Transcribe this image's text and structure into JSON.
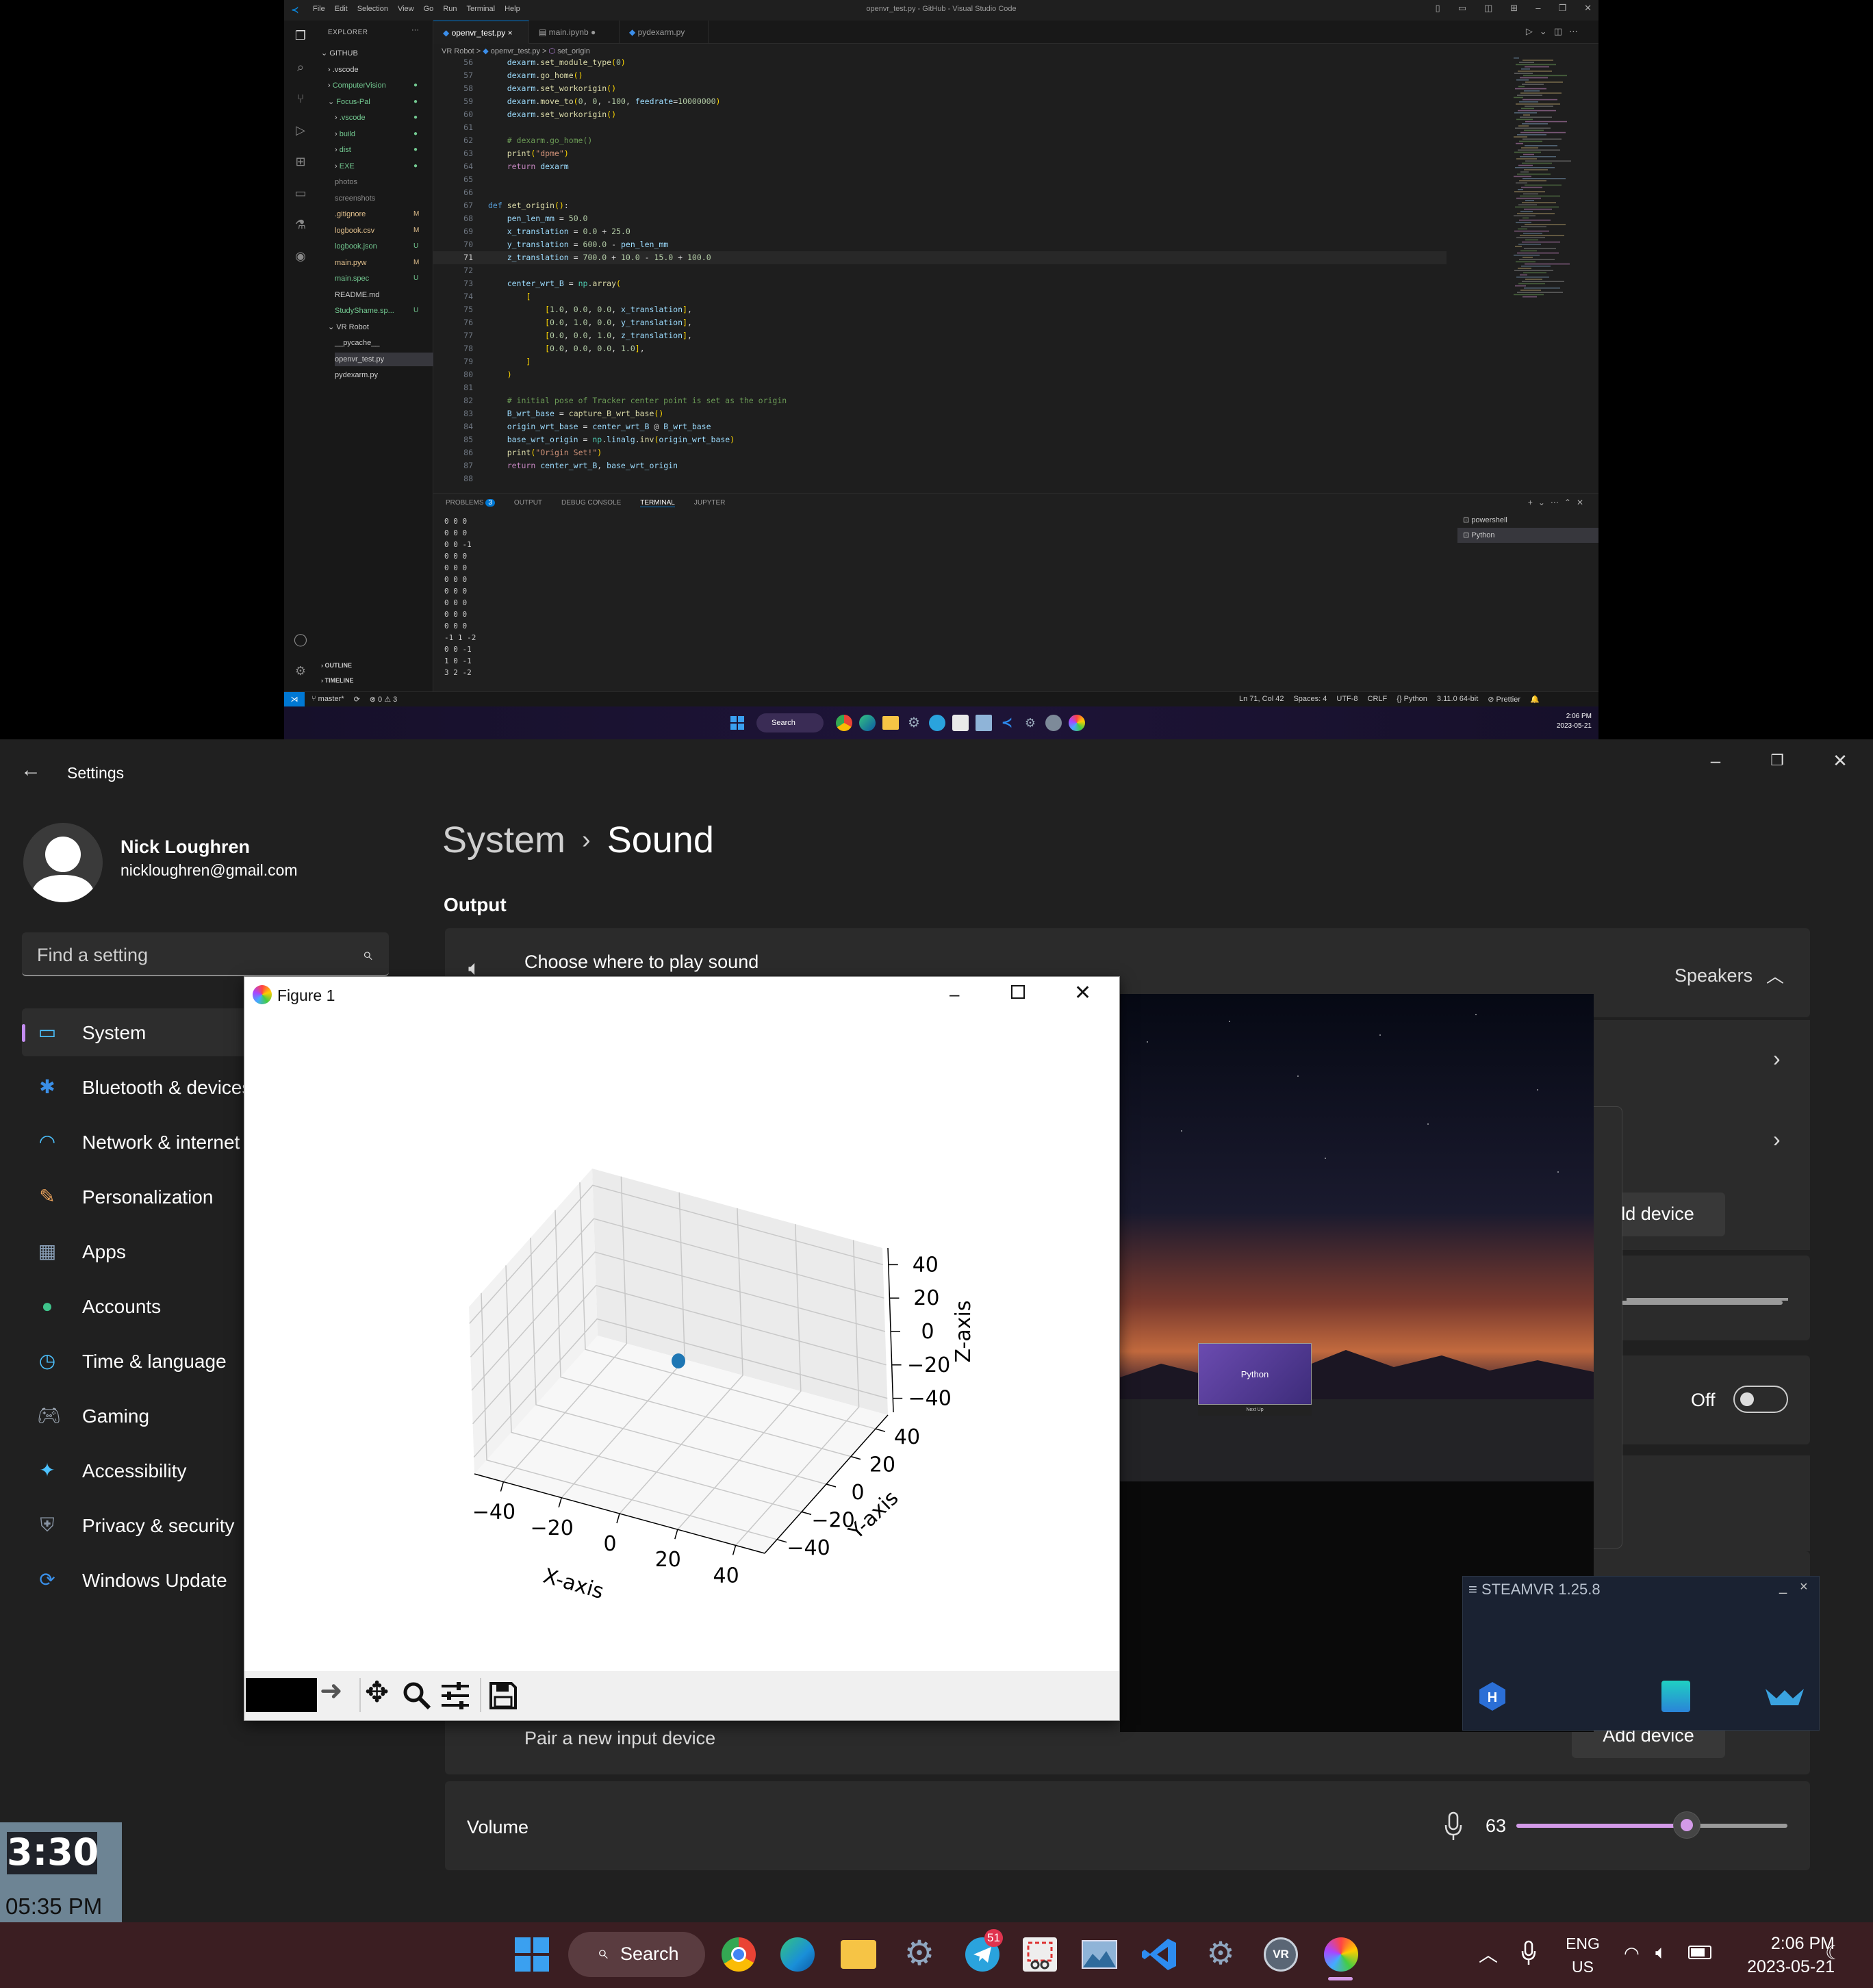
{
  "vscode": {
    "window_title": "openvr_test.py - GitHub - Visual Studio Code",
    "menu": [
      "File",
      "Edit",
      "Selection",
      "View",
      "Go",
      "Run",
      "Terminal",
      "Help"
    ],
    "explorer_header": "EXPLORER",
    "explorer_more": "···",
    "tree": [
      {
        "label": "GITHUB",
        "status": ""
      },
      {
        "label": ".vscode",
        "status": ""
      },
      {
        "label": "ComputerVision",
        "status": "●"
      },
      {
        "label": "Focus-Pal",
        "status": "●"
      },
      {
        "label": ".vscode",
        "status": "●"
      },
      {
        "label": "build",
        "status": "●"
      },
      {
        "label": "dist",
        "status": "●"
      },
      {
        "label": "EXE",
        "status": "●"
      },
      {
        "label": "photos",
        "status": ""
      },
      {
        "label": "screenshots",
        "status": ""
      },
      {
        "label": ".gitignore",
        "status": "M"
      },
      {
        "label": "logbook.csv",
        "status": "M"
      },
      {
        "label": "logbook.json",
        "status": "U"
      },
      {
        "label": "main.pyw",
        "status": "M"
      },
      {
        "label": "main.spec",
        "status": "U"
      },
      {
        "label": "README.md",
        "status": ""
      },
      {
        "label": "StudyShame.sp...",
        "status": "U"
      },
      {
        "label": "VR Robot",
        "status": ""
      },
      {
        "label": "__pycache__",
        "status": ""
      },
      {
        "label": "openvr_test.py",
        "status": ""
      },
      {
        "label": "pydexarm.py",
        "status": ""
      }
    ],
    "outline": "OUTLINE",
    "timeline": "TIMELINE",
    "tabs": [
      {
        "label": "openvr_test.py",
        "mark": "×"
      },
      {
        "label": "main.ipynb",
        "mark": "●"
      },
      {
        "label": "pydexarm.py",
        "mark": ""
      }
    ],
    "breadcrumb": [
      "VR Robot",
      ">",
      "openvr_test.py",
      ">",
      "set_origin"
    ],
    "code": [
      {
        "n": "56",
        "t": "    dexarm.set_module_type(0)"
      },
      {
        "n": "57",
        "t": "    dexarm.go_home()"
      },
      {
        "n": "58",
        "t": "    dexarm.set_workorigin()"
      },
      {
        "n": "59",
        "t": "    dexarm.move_to(0, 0, -100, feedrate=10000000)"
      },
      {
        "n": "60",
        "t": "    dexarm.set_workorigin()"
      },
      {
        "n": "61",
        "t": ""
      },
      {
        "n": "62",
        "t": "    # dexarm.go_home()"
      },
      {
        "n": "63",
        "t": "    print(\"dpme\")"
      },
      {
        "n": "64",
        "t": "    return dexarm"
      },
      {
        "n": "65",
        "t": ""
      },
      {
        "n": "66",
        "t": ""
      },
      {
        "n": "67",
        "t": "def set_origin():"
      },
      {
        "n": "68",
        "t": "    pen_len_mm = 50.0"
      },
      {
        "n": "69",
        "t": "    x_translation = 0.0 + 25.0"
      },
      {
        "n": "70",
        "t": "    y_translation = 600.0 - pen_len_mm"
      },
      {
        "n": "71",
        "t": "    z_translation = 700.0 + 10.0 - 15.0 + 100.0"
      },
      {
        "n": "72",
        "t": ""
      },
      {
        "n": "73",
        "t": "    center_wrt_B = np.array("
      },
      {
        "n": "74",
        "t": "        ["
      },
      {
        "n": "75",
        "t": "            [1.0, 0.0, 0.0, x_translation],"
      },
      {
        "n": "76",
        "t": "            [0.0, 1.0, 0.0, y_translation],"
      },
      {
        "n": "77",
        "t": "            [0.0, 0.0, 1.0, z_translation],"
      },
      {
        "n": "78",
        "t": "            [0.0, 0.0, 0.0, 1.0],"
      },
      {
        "n": "79",
        "t": "        ]"
      },
      {
        "n": "80",
        "t": "    )"
      },
      {
        "n": "81",
        "t": ""
      },
      {
        "n": "82",
        "t": "    # initial pose of Tracker center point is set as the origin"
      },
      {
        "n": "83",
        "t": "    B_wrt_base = capture_B_wrt_base()"
      },
      {
        "n": "84",
        "t": "    origin_wrt_base = center_wrt_B @ B_wrt_base"
      },
      {
        "n": "85",
        "t": "    base_wrt_origin = np.linalg.inv(origin_wrt_base)"
      },
      {
        "n": "86",
        "t": "    print(\"Origin Set!\")"
      },
      {
        "n": "87",
        "t": "    return center_wrt_B, base_wrt_origin"
      },
      {
        "n": "88",
        "t": ""
      }
    ],
    "panel_tabs": [
      "PROBLEMS",
      "OUTPUT",
      "DEBUG CONSOLE",
      "TERMINAL",
      "JUPYTER"
    ],
    "problems_count": "3",
    "terminal_lines": [
      "0 0 0",
      "0 0 0",
      "0 0 -1",
      "0 0 0",
      "0 0 0",
      "0 0 0",
      "0 0 0",
      "0 0 0",
      "0 0 0",
      "0 0 0",
      "-1 1 -2",
      "0 0 -1",
      "1 0 -1",
      "3 2 -2"
    ],
    "shells": [
      "powershell",
      "Python"
    ],
    "status_left": [
      "master*",
      "⟳",
      "⊗ 0 ⚠ 3"
    ],
    "status_right": [
      "Ln 71, Col 42",
      "Spaces: 4",
      "UTF-8",
      "CRLF",
      "{} Python",
      "3.11.0 64-bit",
      "⊘ Prettier"
    ],
    "taskbar_search": "Search",
    "taskbar_time": "2:06 PM",
    "taskbar_date": "2023-05-21",
    "badge_count": "51"
  },
  "settings": {
    "title": "Settings",
    "user_name": "Nick Loughren",
    "user_email": "nickloughren@gmail.com",
    "search_placeholder": "Find a setting",
    "nav": [
      {
        "label": "System",
        "icon": "monitor-icon"
      },
      {
        "label": "Bluetooth & devices",
        "icon": "bluetooth-icon"
      },
      {
        "label": "Network & internet",
        "icon": "wifi-icon"
      },
      {
        "label": "Personalization",
        "icon": "brush-icon"
      },
      {
        "label": "Apps",
        "icon": "apps-icon"
      },
      {
        "label": "Accounts",
        "icon": "accounts-icon"
      },
      {
        "label": "Time & language",
        "icon": "clock-icon"
      },
      {
        "label": "Gaming",
        "icon": "gamepad-icon"
      },
      {
        "label": "Accessibility",
        "icon": "accessibility-icon"
      },
      {
        "label": "Privacy & security",
        "icon": "shield-icon"
      },
      {
        "label": "Windows Update",
        "icon": "update-icon"
      }
    ],
    "breadcrumb_parent": "System",
    "breadcrumb_sep": "›",
    "breadcrumb_current": "Sound",
    "section_output": "Output",
    "choose_sound": "Choose where to play sound",
    "speakers": "Speakers",
    "add_device": "Add device",
    "off_label": "Off",
    "pair_input": "Pair a new input device",
    "volume_label": "Volume",
    "volume_value": "63",
    "volume_level": 0.63
  },
  "figure": {
    "title": "Figure 1"
  },
  "chart_data": {
    "type": "scatter",
    "projection": "3d",
    "title": "",
    "xlabel": "X-axis",
    "ylabel": "Y-axis",
    "zlabel": "Z-axis",
    "xlim": [
      -50,
      50
    ],
    "ylim": [
      -50,
      50
    ],
    "zlim": [
      -50,
      50
    ],
    "x_ticks": [
      "−40",
      "−20",
      "0",
      "20",
      "40"
    ],
    "y_ticks": [
      "40",
      "20",
      "0",
      "−20",
      "−40"
    ],
    "z_ticks": [
      "40",
      "20",
      "0",
      "−20",
      "−40"
    ],
    "points": [
      {
        "x": 0,
        "y": 0,
        "z": 0
      }
    ],
    "color": "#1f77b4",
    "grid": true
  },
  "vr": {
    "panel_title": "Python",
    "panel_sub": "Next Up"
  },
  "steamvr": {
    "title": "≡ STEAMVR 1.25.8",
    "min": "_",
    "close": "×"
  },
  "clock_widget": {
    "big": "3:30",
    "small": "05:35 PM"
  },
  "taskbar": {
    "search": "Search",
    "badge": "51",
    "lang_top": "ENG",
    "lang_bottom": "US",
    "time": "2:06 PM",
    "date": "2023-05-21"
  },
  "colors": {
    "accent": "#c38cf0",
    "volume": "#d39ae8",
    "vscode_blue": "#0078d4"
  }
}
